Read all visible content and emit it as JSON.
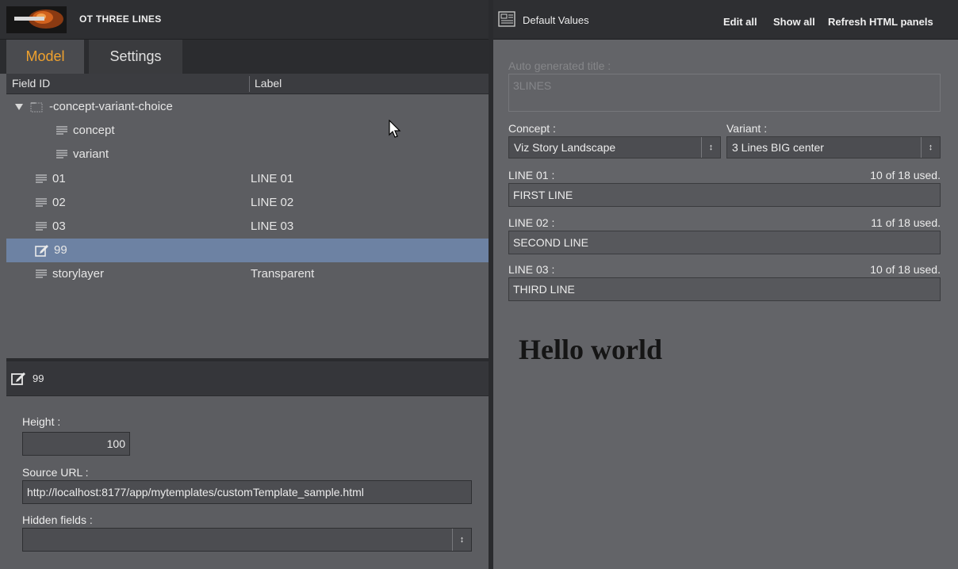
{
  "app": {
    "template_title": "OT THREE LINES",
    "colors": {
      "active_tab": "#f0a22e",
      "selection": "#6d82a3",
      "header_bg": "#2e2f32"
    }
  },
  "tabs": [
    {
      "label": "Model",
      "active": true
    },
    {
      "label": "Settings",
      "active": false
    }
  ],
  "tree": {
    "columns": [
      "Field ID",
      "Label"
    ],
    "rows": [
      {
        "id": "-concept-variant-choice",
        "label": "",
        "icon": "folder-icon",
        "expanded": true
      },
      {
        "id": "concept",
        "label": "",
        "icon": "text-lines-icon"
      },
      {
        "id": "variant",
        "label": "",
        "icon": "text-lines-icon"
      },
      {
        "id": "01",
        "label": "LINE 01",
        "icon": "text-lines-icon"
      },
      {
        "id": "02",
        "label": "LINE 02",
        "icon": "text-lines-icon"
      },
      {
        "id": "03",
        "label": "LINE 03",
        "icon": "text-lines-icon"
      },
      {
        "id": "99",
        "label": "",
        "icon": "edit-icon",
        "selected": true
      },
      {
        "id": "storylayer",
        "label": "Transparent",
        "icon": "text-lines-icon"
      }
    ]
  },
  "properties": {
    "title": "99",
    "height_label": "Height :",
    "height_value": "100",
    "source_url_label": "Source URL :",
    "source_url_value": "http://localhost:8177/app/mytemplates/customTemplate_sample.html",
    "hidden_fields_label": "Hidden fields :",
    "hidden_fields_value": ""
  },
  "right_panel": {
    "title": "Default Values",
    "buttons": {
      "edit_all": "Edit all",
      "show_all": "Show all",
      "refresh": "Refresh HTML panels"
    },
    "auto_title_label": "Auto generated title :",
    "auto_title_value": "3LINES",
    "concept_label": "Concept :",
    "concept_value": "Viz Story Landscape",
    "variant_label": "Variant :",
    "variant_value": "3 Lines BIG center",
    "lines": [
      {
        "label": "LINE 01 :",
        "count": "10 of 18 used.",
        "value": "FIRST LINE"
      },
      {
        "label": "LINE 02 :",
        "count": "11 of 18 used.",
        "value": "SECOND LINE"
      },
      {
        "label": "LINE 03 :",
        "count": "10 of 18 used.",
        "value": "THIRD LINE"
      }
    ],
    "html_preview_text": "Hello world"
  }
}
